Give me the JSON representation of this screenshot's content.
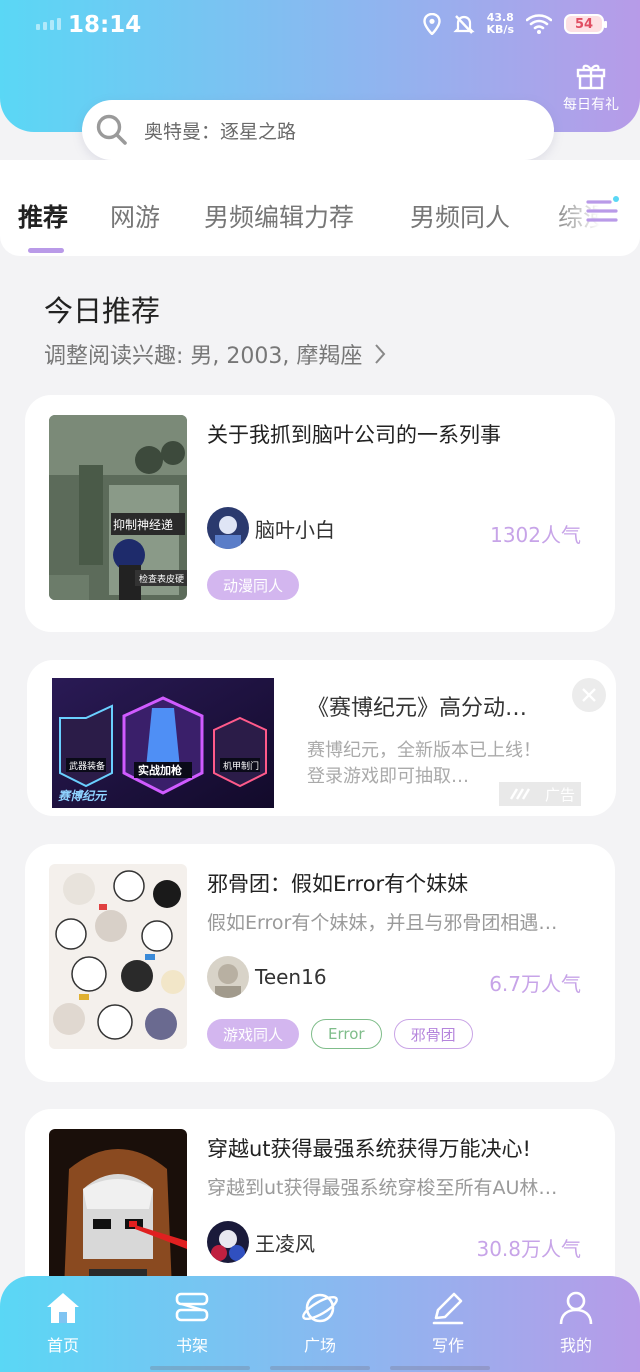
{
  "status_bar": {
    "time": "18:14",
    "net_speed_value": "43.8",
    "net_speed_unit": "KB/s",
    "battery": "54"
  },
  "header": {
    "gift_label": "每日有礼",
    "search_placeholder": "奥特曼：逐星之路"
  },
  "tabs": [
    {
      "label": "推荐",
      "active": true
    },
    {
      "label": "网游",
      "active": false
    },
    {
      "label": "男频编辑力荐",
      "active": false
    },
    {
      "label": "男频同人",
      "active": false
    },
    {
      "label": "综漫",
      "active": false
    }
  ],
  "section": {
    "title": "今日推荐",
    "subtitle": "调整阅读兴趣: 男, 2003, 摩羯座"
  },
  "books": [
    {
      "title": "关于我抓到脑叶公司的一系列事",
      "description": "",
      "author": "脑叶小白",
      "popularity": "1302人气",
      "tags": [
        "动漫同人"
      ],
      "cover_text_1": "抑制神经递",
      "cover_text_2": "检查表皮硬"
    },
    {
      "title": "邪骨团：假如Error有个妹妹",
      "description": "假如Error有个妹妹，并且与邪骨团相遇…",
      "author": "Teen16",
      "popularity": "6.7万人气",
      "tags": [
        "游戏同人",
        "Error",
        "邪骨团"
      ]
    },
    {
      "title": "穿越ut获得最强系统获得万能决心!",
      "description": "穿越到ut获得最强系统穿梭至所有AU林…",
      "author": "王凌风",
      "popularity": "30.8万人气",
      "tags": []
    }
  ],
  "ad": {
    "title": "《赛博纪元》高分动…",
    "description": "赛博纪元，全新版本已上线！登录游戏即可抽取…",
    "badge": "广告",
    "image_label_left": "武器装备",
    "image_label_center": "实战加枪",
    "image_label_right": "机甲制门",
    "image_logo": "赛博纪元"
  },
  "bottom_nav": [
    {
      "label": "首页",
      "icon": "home-icon"
    },
    {
      "label": "书架",
      "icon": "bookshelf-icon"
    },
    {
      "label": "广场",
      "icon": "planet-icon"
    },
    {
      "label": "写作",
      "icon": "pen-icon"
    },
    {
      "label": "我的",
      "icon": "user-icon"
    }
  ],
  "colors": {
    "gradient_start": "#5ad7f5",
    "gradient_end": "#b79be8",
    "accent_purple": "#c7a4e8",
    "tag_fill": "#d3b6ef"
  }
}
